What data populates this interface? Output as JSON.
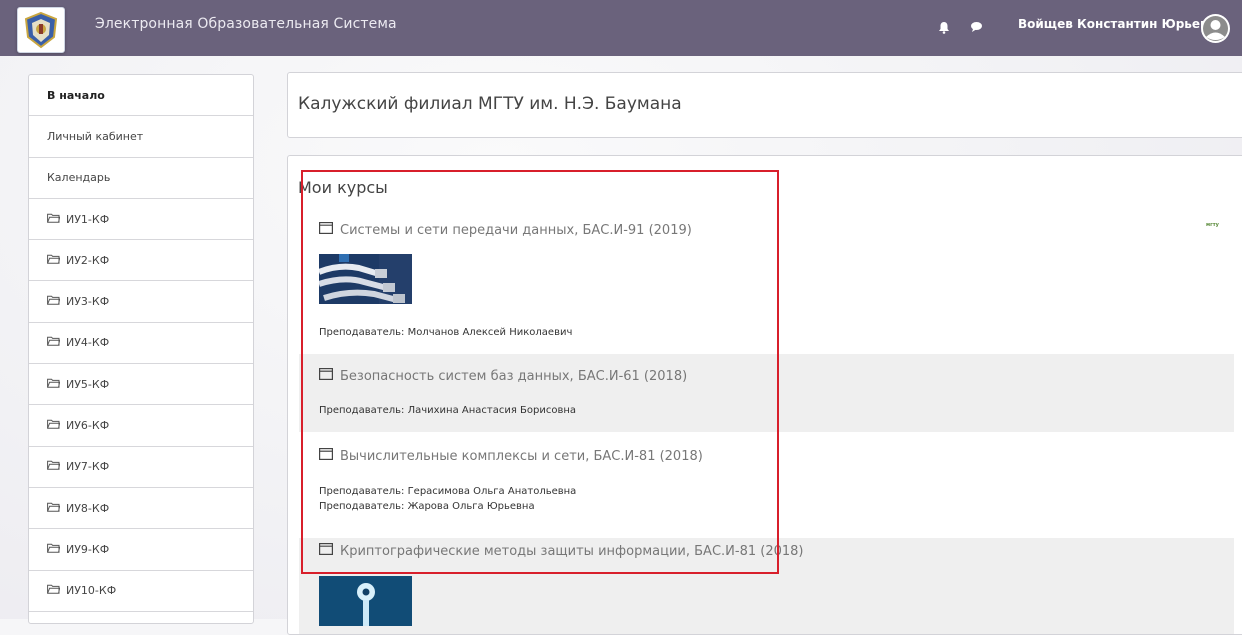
{
  "header": {
    "site_title": "Электронная Образовательная Система",
    "user_name": "Войщев Константин Юрьевич",
    "icons": [
      "bell-icon",
      "chat-icon",
      "avatar-icon"
    ]
  },
  "sidebar": {
    "items": [
      {
        "label": "В начало",
        "active": true,
        "folder": false
      },
      {
        "label": "Личный кабинет",
        "active": false,
        "folder": false
      },
      {
        "label": "Календарь",
        "active": false,
        "folder": false
      },
      {
        "label": "ИУ1-КФ",
        "active": false,
        "folder": true
      },
      {
        "label": "ИУ2-КФ",
        "active": false,
        "folder": true
      },
      {
        "label": "ИУ3-КФ",
        "active": false,
        "folder": true
      },
      {
        "label": "ИУ4-КФ",
        "active": false,
        "folder": true
      },
      {
        "label": "ИУ5-КФ",
        "active": false,
        "folder": true
      },
      {
        "label": "ИУ6-КФ",
        "active": false,
        "folder": true
      },
      {
        "label": "ИУ7-КФ",
        "active": false,
        "folder": true
      },
      {
        "label": "ИУ8-КФ",
        "active": false,
        "folder": true
      },
      {
        "label": "ИУ9-КФ",
        "active": false,
        "folder": true
      },
      {
        "label": "ИУ10-КФ",
        "active": false,
        "folder": true
      }
    ]
  },
  "main": {
    "page_title": "Калужский филиал МГТУ им. Н.Э. Баумана",
    "courses_heading": "Мои курсы",
    "side_tag": "мгту",
    "teacher_label": "Преподаватель:",
    "courses": [
      {
        "title": "Системы и сети передачи данных, БАС.И-91 (2019)",
        "teachers": [
          "Молчанов Алексей Николаевич"
        ]
      },
      {
        "title": "Безопасность систем баз данных, БАС.И-61 (2018)",
        "teachers": [
          "Лачихина Анастасия Борисовна"
        ]
      },
      {
        "title": "Вычислительные комплексы и сети, БАС.И-81 (2018)",
        "teachers": [
          "Герасимова Ольга Анатольевна",
          "Жарова Ольга Юрьевна"
        ]
      },
      {
        "title": "Криптографические методы защиты информации, БАС.И-81 (2018)",
        "teachers": []
      }
    ]
  },
  "colors": {
    "topbar": "#6a627c",
    "highlight": "#d81f2b",
    "shaded_row": "#efefef"
  }
}
